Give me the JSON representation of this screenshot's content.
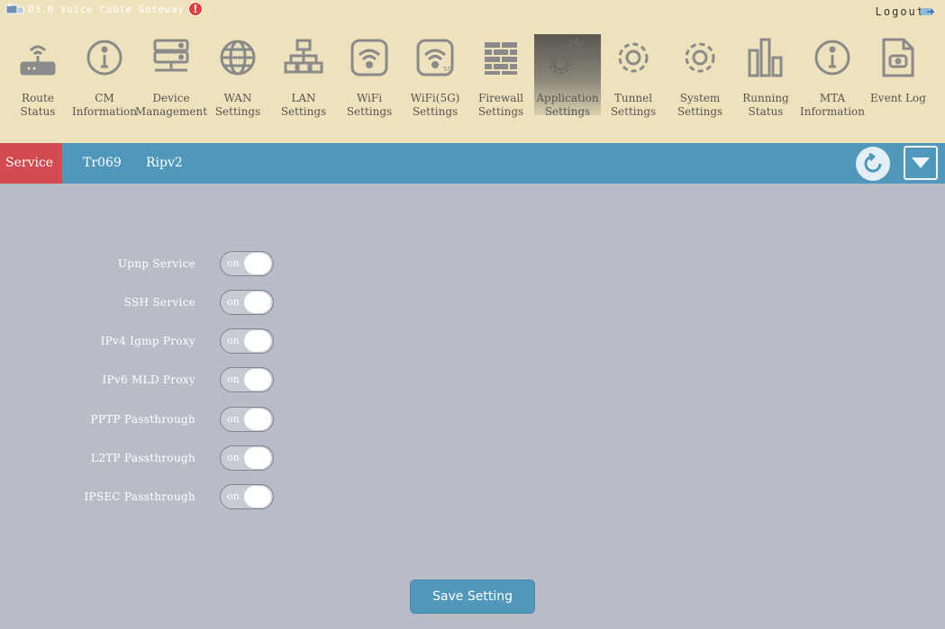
{
  "header": {
    "title": "D3.0 Voice Cable Gateway",
    "title_logo_icon": "gateway-logo-icon",
    "warning_icon": "warning-icon",
    "logout_label": "Logout",
    "logout_icon": "logout-arrow-icon"
  },
  "nav": [
    {
      "label": "Route\nStatus",
      "icon": "router-icon"
    },
    {
      "label": "CM\nInformation",
      "icon": "info-circle-icon"
    },
    {
      "label": "Device\nManagement",
      "icon": "server-icon"
    },
    {
      "label": "WAN\nSettings",
      "icon": "globe-icon"
    },
    {
      "label": "LAN\nSettings",
      "icon": "network-tree-icon"
    },
    {
      "label": "WiFi\nSettings",
      "icon": "wifi-icon"
    },
    {
      "label": "WiFi(5G)\nSettings",
      "icon": "wifi-5g-icon"
    },
    {
      "label": "Firewall\nSettings",
      "icon": "brick-wall-icon"
    },
    {
      "label": "Application\nSettings",
      "icon": "gears-icon",
      "active": true
    },
    {
      "label": "Tunnel\nSettings",
      "icon": "gear-icon"
    },
    {
      "label": "System\nSettings",
      "icon": "gear-icon"
    },
    {
      "label": "Running\nStatus",
      "icon": "bar-chart-icon"
    },
    {
      "label": "MTA\nInformation",
      "icon": "info-circle-icon"
    },
    {
      "label": "Event Log",
      "icon": "log-file-icon"
    }
  ],
  "tabs": [
    {
      "label": "Service",
      "active": true
    },
    {
      "label": "Tr069",
      "active": false
    },
    {
      "label": "Ripv2",
      "active": false
    }
  ],
  "toolbar": {
    "refresh_icon": "refresh-icon",
    "dropdown_icon": "triangle-down-icon"
  },
  "settings": [
    {
      "label": "Upnp Service",
      "state": "on"
    },
    {
      "label": "SSH Service",
      "state": "on"
    },
    {
      "label": "IPv4 Igmp Proxy",
      "state": "on"
    },
    {
      "label": "IPv6 MLD Proxy",
      "state": "on"
    },
    {
      "label": "PPTP Passthrough",
      "state": "on"
    },
    {
      "label": "L2TP Passthrough",
      "state": "on"
    },
    {
      "label": "IPSEC Passthrough",
      "state": "on"
    }
  ],
  "save_label": "Save Setting",
  "colors": {
    "header_bg": "#ede2bb",
    "tabbar_bg": "#4f98bc",
    "active_tab_bg": "#d34a50",
    "content_bg": "#b8bcc6"
  }
}
